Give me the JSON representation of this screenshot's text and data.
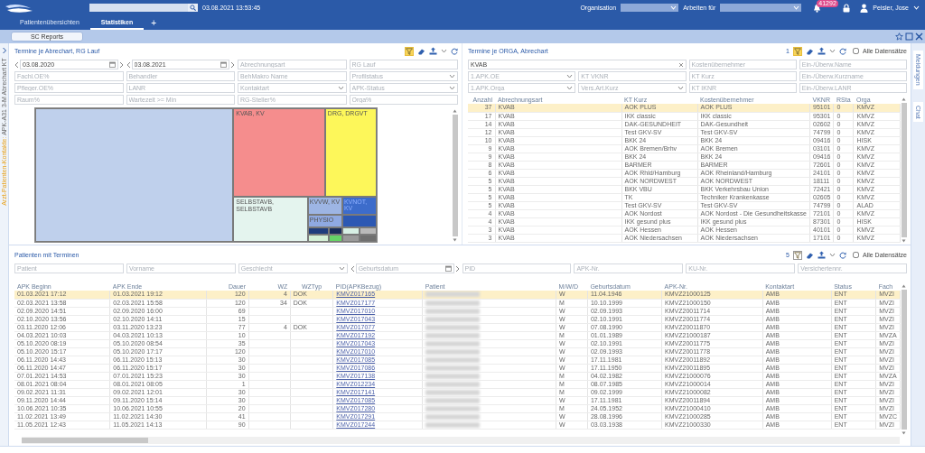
{
  "header": {
    "datetime": "03.08.2021 13:53:45",
    "organisation_label": "Organisation",
    "work_for_label": "Arbeiten für",
    "notification_count": "41292",
    "user": "Peisler, Jose"
  },
  "tabs": [
    {
      "label": "Patientenübersichten",
      "selected": false
    },
    {
      "label": "Statistiken",
      "selected": true
    }
  ],
  "add_tab": "+",
  "report_button": "SC Reports",
  "side_panel": {
    "highlight": "Arzt-Patienten-Kontakte:",
    "title": "APK-A31 3-M Abrechart KT"
  },
  "right_tabs": [
    {
      "label": "Meldungen"
    },
    {
      "label": "Chat"
    }
  ],
  "panels": [
    {
      "title": "Termine je Abrechart, RG Lauf",
      "toolbar": {
        "filter_active": true
      },
      "filters": [
        {
          "kind": "date",
          "value": "03.08.2020"
        },
        {
          "kind": "date",
          "value": "03.08.2021"
        },
        {
          "kind": "text",
          "placeholder": "Abrechnungsart"
        },
        {
          "kind": "text",
          "placeholder": "RG Lauf"
        },
        {
          "kind": "text",
          "placeholder": "Fachl.OE%"
        },
        {
          "kind": "text",
          "placeholder": "Behandler"
        },
        {
          "kind": "text",
          "placeholder": "BehMakro Name"
        },
        {
          "kind": "select",
          "placeholder": "Profilstatus"
        },
        {
          "kind": "text",
          "placeholder": "Pfleger.OE%"
        },
        {
          "kind": "text",
          "placeholder": "LANR"
        },
        {
          "kind": "select",
          "placeholder": "Kontaktart"
        },
        {
          "kind": "select",
          "placeholder": "APK-Status"
        },
        {
          "kind": "text",
          "placeholder": "Raum%"
        },
        {
          "kind": "text",
          "placeholder": "Wartezeit >= Min"
        },
        {
          "kind": "text",
          "placeholder": "RG-Steller%"
        },
        {
          "kind": "text",
          "placeholder": "Orga%"
        }
      ],
      "treemap": {
        "cells": [
          {
            "color": "#bfd0ec"
          },
          {
            "label": "KVAB, KV",
            "color": "#f58d8d"
          },
          {
            "label": "DRG, DRGVT",
            "color": "#fdf75a"
          },
          {
            "label": "SELBSTAVB, SELBSTAVB",
            "color": "#e4f4ee"
          },
          {
            "label": "KVVW, KV",
            "color": "#9db5e4"
          },
          {
            "label": "KVNOT, KV",
            "color": "#3d6ccb"
          },
          {
            "label": "PHYSIO",
            "color": "#8fa9e2"
          },
          {
            "color": "#2c58b3"
          },
          {
            "color": "#1f3c7c"
          },
          {
            "color": "#1a2d5a"
          },
          {
            "color": "#d7efe4"
          },
          {
            "color": "#b9b9b9"
          },
          {
            "color": "#d4f0d6"
          },
          {
            "color": "#66d466"
          },
          {
            "color": "#9a9a9a"
          },
          {
            "color": "#6f6f6f"
          }
        ]
      }
    },
    {
      "title": "Termine je ORGA, Abrechart",
      "toolbar": {
        "count": "1",
        "filter_active": true,
        "all_records": {
          "label": "Alle Datensätze",
          "checked": false
        }
      },
      "filters": [
        {
          "kind": "clearable",
          "value": "KVAB"
        },
        {
          "kind": "text",
          "placeholder": "Kostenübernehmer"
        },
        {
          "kind": "text",
          "placeholder": "Ein-/Überw.Name"
        },
        {
          "kind": "select",
          "placeholder": "1.APK.OE"
        },
        {
          "kind": "text",
          "placeholder": "KT VKNR"
        },
        {
          "kind": "text",
          "placeholder": "KT Kurz"
        },
        {
          "kind": "text",
          "placeholder": "Ein-/Überw.Kurzname"
        },
        {
          "kind": "select",
          "placeholder": "1.APK.Orga"
        },
        {
          "kind": "select",
          "placeholder": "Vers.Art.Kurz"
        },
        {
          "kind": "text",
          "placeholder": "KT IKNR"
        },
        {
          "kind": "text",
          "placeholder": "Ein-/Überw.LANR"
        }
      ],
      "table": {
        "columns": [
          {
            "label": "Anzahl",
            "kind": "text"
          },
          {
            "label": "Abrechnungsart",
            "kind": "text"
          },
          {
            "label": "KT Kurz",
            "kind": "text"
          },
          {
            "label": "Kostenübernehmer",
            "kind": "text"
          },
          {
            "label": "VKNR",
            "kind": "text"
          },
          {
            "label": "RSta",
            "kind": "text"
          },
          {
            "label": "Orga",
            "kind": "text"
          }
        ],
        "rows": [
          {
            "selected": true,
            "cells": [
              "37",
              "KVAB",
              "AOK PLUS",
              "AOK PLUS",
              "95101",
              "0",
              "KMVZ"
            ]
          },
          {
            "selected": false,
            "cells": [
              "17",
              "KVAB",
              "IKK classic",
              "IKK classic",
              "95301",
              "0",
              "KMVZ"
            ]
          },
          {
            "selected": false,
            "cells": [
              "14",
              "KVAB",
              "DAK-GESUNDHEIT",
              "DAK-Gesundheit",
              "02602",
              "0",
              "KMVZ"
            ]
          },
          {
            "selected": false,
            "cells": [
              "12",
              "KVAB",
              "Test GKV-SV",
              "Test GKV-SV",
              "74799",
              "0",
              "KMVZ"
            ]
          },
          {
            "selected": false,
            "cells": [
              "10",
              "KVAB",
              "BKK 24",
              "BKK 24",
              "09416",
              "0",
              "HISK"
            ]
          },
          {
            "selected": false,
            "cells": [
              "9",
              "KVAB",
              "AOK Bremen/Brhv",
              "AOK Bremen",
              "03101",
              "0",
              "KMVZ"
            ]
          },
          {
            "selected": false,
            "cells": [
              "9",
              "KVAB",
              "BKK 24",
              "BKK 24",
              "09416",
              "0",
              "KMVZ"
            ]
          },
          {
            "selected": false,
            "cells": [
              "8",
              "KVAB",
              "BARMER",
              "BARMER",
              "72601",
              "0",
              "KMVZ"
            ]
          },
          {
            "selected": false,
            "cells": [
              "6",
              "KVAB",
              "AOK Rhld/Hamburg",
              "AOK Rheinland/Hamburg",
              "24101",
              "0",
              "KMVZ"
            ]
          },
          {
            "selected": false,
            "cells": [
              "5",
              "KVAB",
              "AOK NORDWEST",
              "AOK NORDWEST",
              "18111",
              "0",
              "KMVZ"
            ]
          },
          {
            "selected": false,
            "cells": [
              "5",
              "KVAB",
              "BKK VBU",
              "BKK Verkehrsbau Union",
              "72421",
              "0",
              "KMVZ"
            ]
          },
          {
            "selected": false,
            "cells": [
              "5",
              "KVAB",
              "TK",
              "Techniker Krankenkasse",
              "02605",
              "0",
              "KMVZ"
            ]
          },
          {
            "selected": false,
            "cells": [
              "5",
              "KVAB",
              "Test GKV-SV",
              "Test GKV-SV",
              "74799",
              "0",
              "ALAD"
            ]
          },
          {
            "selected": false,
            "cells": [
              "4",
              "KVAB",
              "AOK Nordost",
              "AOK Nordost - Die Gesundheitskasse",
              "72101",
              "0",
              "KMVZ"
            ]
          },
          {
            "selected": false,
            "cells": [
              "4",
              "KVAB",
              "IKK gesund plus",
              "IKK gesund plus",
              "87301",
              "0",
              "HISK"
            ]
          },
          {
            "selected": false,
            "cells": [
              "3",
              "KVAB",
              "AOK Hessen",
              "AOK Hessen",
              "40101",
              "0",
              "KMVZ"
            ]
          },
          {
            "selected": false,
            "cells": [
              "3",
              "KVAB",
              "AOK Niedersachsen",
              "AOK Niedersachsen",
              "17101",
              "0",
              "KMVZ"
            ]
          }
        ]
      }
    },
    {
      "title": "Patienten mit Terminen",
      "toolbar": {
        "count": "5",
        "filter_active": false,
        "all_records": {
          "label": "Alle Datensätze",
          "checked": false
        }
      },
      "filters": [
        {
          "kind": "text",
          "placeholder": "Patient"
        },
        {
          "kind": "text",
          "placeholder": "Vorname"
        },
        {
          "kind": "select",
          "placeholder": "Geschlecht"
        },
        {
          "kind": "date",
          "placeholder": "Geburtsdatum"
        },
        {
          "kind": "text",
          "placeholder": "PID"
        },
        {
          "kind": "text",
          "placeholder": "APK-Nr."
        },
        {
          "kind": "text",
          "placeholder": "KU-Nr."
        },
        {
          "kind": "text",
          "placeholder": "Versichertennr."
        }
      ],
      "table": {
        "columns": [
          {
            "label": "APK Beginn",
            "kind": "text"
          },
          {
            "label": "APK Ende",
            "kind": "text"
          },
          {
            "label": "Dauer",
            "kind": "text"
          },
          {
            "label": "WZ",
            "kind": "text"
          },
          {
            "label": "WZTyp",
            "kind": "text"
          },
          {
            "label": "PID(APKBezug)",
            "kind": "link"
          },
          {
            "label": "Patient",
            "kind": "redacted"
          },
          {
            "label": "M/W/D",
            "kind": "text"
          },
          {
            "label": "Geburtsdatum",
            "kind": "text"
          },
          {
            "label": "APK-Nr.",
            "kind": "text"
          },
          {
            "label": "Kontaktart",
            "kind": "text"
          },
          {
            "label": "Status",
            "kind": "text"
          },
          {
            "label": "Fach",
            "kind": "text"
          }
        ],
        "rows": [
          {
            "selected": true,
            "cells": [
              "01.03.2021 17:12",
              "01.03.2021 19:12",
              "120",
              "4",
              "DOK",
              "KMVZ017165",
              null,
              "W",
              "11.04.1946",
              "KMVZ21000125",
              "AMB",
              "ENT",
              "MVZI"
            ]
          },
          {
            "selected": false,
            "cells": [
              "02.03.2021 13:58",
              "02.03.2021 15:58",
              "120",
              "34",
              "DOK",
              "KMVZ017177",
              null,
              "M",
              "10.10.1999",
              "KMVZ21000150",
              "AMB",
              "ENT",
              "MVZI"
            ]
          },
          {
            "selected": false,
            "cells": [
              "02.09.2020 14:51",
              "02.09.2020 16:00",
              "69",
              null,
              null,
              "KMVZ017010",
              null,
              "W",
              "02.09.1993",
              "KMVZ20011714",
              "AMB",
              "ENT",
              "MVZI"
            ]
          },
          {
            "selected": false,
            "cells": [
              "02.10.2020 13:56",
              "02.10.2020 14:11",
              "15",
              null,
              null,
              "KMVZ017043",
              null,
              "W",
              "02.10.1991",
              "KMVZ20011774",
              "AMB",
              "ENT",
              "MVZI"
            ]
          },
          {
            "selected": false,
            "cells": [
              "03.11.2020 12:06",
              "03.11.2020 13:23",
              "77",
              "4",
              "DOK",
              "KMVZ017077",
              null,
              "W",
              "07.08.1990",
              "KMVZ20011870",
              "AMB",
              "ENT",
              "MVZI"
            ]
          },
          {
            "selected": false,
            "cells": [
              "04.03.2021 10:03",
              "04.03.2021 10:13",
              "10",
              null,
              null,
              "KMVZ017192",
              null,
              "M",
              "01.01.1989",
              "KMVZ21000187",
              "AMB",
              "ENT",
              "MVZA"
            ]
          },
          {
            "selected": false,
            "cells": [
              "05.10.2020 08:19",
              "05.10.2020 08:54",
              "35",
              null,
              null,
              "KMVZ017043",
              null,
              "W",
              "02.10.1991",
              "KMVZ20011775",
              "AMB",
              "ENT",
              "MVZI"
            ]
          },
          {
            "selected": false,
            "cells": [
              "05.10.2020 15:17",
              "05.10.2020 17:17",
              "120",
              null,
              null,
              "KMVZ017010",
              null,
              "W",
              "02.09.1993",
              "KMVZ20011778",
              "AMB",
              "ENT",
              "MVZI"
            ]
          },
          {
            "selected": false,
            "cells": [
              "06.11.2020 14:43",
              "06.11.2020 15:13",
              "30",
              null,
              null,
              "KMVZ017085",
              null,
              "W",
              "17.11.1981",
              "KMVZ20011892",
              "AMB",
              "ENT",
              "MVZI"
            ]
          },
          {
            "selected": false,
            "cells": [
              "06.11.2020 14:47",
              "06.11.2020 15:17",
              "30",
              null,
              null,
              "KMVZ017086",
              null,
              "W",
              "17.11.1950",
              "KMVZ20011895",
              "AMB",
              "ENT",
              "MVZI"
            ]
          },
          {
            "selected": false,
            "cells": [
              "07.01.2021 14:53",
              "07.01.2021 15:23",
              "30",
              null,
              null,
              "KMVZ017138",
              null,
              "M",
              "04.02.1982",
              "KMVZ21000076",
              "AMB",
              "ENT",
              "MVZA"
            ]
          },
          {
            "selected": false,
            "cells": [
              "08.01.2021 08:04",
              "08.01.2021 08:05",
              "1",
              null,
              null,
              "KMVZ012234",
              null,
              "M",
              "08.07.1985",
              "KMVZ21000014",
              "AMB",
              "ENT",
              "MVZI"
            ]
          },
          {
            "selected": false,
            "cells": [
              "09.02.2021 11:31",
              "09.02.2021 12:01",
              "30",
              null,
              null,
              "KMVZ017141",
              null,
              "M",
              "09.02.1999",
              "KMVZ21000082",
              "AMB",
              "ENT",
              "MVZI"
            ]
          },
          {
            "selected": false,
            "cells": [
              "09.11.2020 14:44",
              "09.11.2020 15:14",
              "30",
              null,
              null,
              "KMVZ017085",
              null,
              "W",
              "17.11.1981",
              "KMVZ20011894",
              "AMB",
              "ENT",
              "MVZI"
            ]
          },
          {
            "selected": false,
            "cells": [
              "10.06.2021 10:35",
              "10.06.2021 10:55",
              "20",
              null,
              null,
              "KMVZ017280",
              null,
              "M",
              "24.05.1952",
              "KMVZ21000410",
              "AMB",
              "ENT",
              "MVZI"
            ]
          },
          {
            "selected": false,
            "cells": [
              "11.02.2021 13:49",
              "11.02.2021 14:30",
              "41",
              null,
              null,
              "KMVZ017291",
              null,
              "W",
              "28.08.1996",
              "KMVZ21000285",
              "AMB",
              "ENT",
              "MVZC"
            ]
          },
          {
            "selected": false,
            "cells": [
              "11.05.2021 12:43",
              "11.05.2021 14:13",
              "90",
              null,
              null,
              "KMVZ017244",
              null,
              "W",
              "03.03.1938",
              "KMVZ21000330",
              "AMB",
              "ENT",
              "MVZI"
            ]
          }
        ]
      }
    }
  ]
}
